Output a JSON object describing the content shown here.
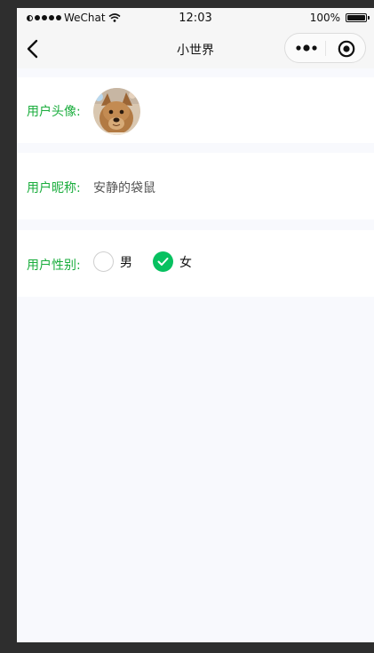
{
  "status_bar": {
    "carrier": "WeChat",
    "time": "12:03",
    "battery": "100%"
  },
  "nav": {
    "title": "小世界",
    "back_icon": "chevron-left-icon",
    "more_icon": "more-dots-icon",
    "close_icon": "record-circle-icon"
  },
  "profile": {
    "avatar_label": "用户头像:",
    "nickname_label": "用户昵称:",
    "nickname_value": "安静的袋鼠",
    "gender_label": "用户性别:",
    "gender_options": [
      {
        "label": "男",
        "checked": false
      },
      {
        "label": "女",
        "checked": true
      }
    ]
  },
  "colors": {
    "label": "#1aad3d",
    "radio_checked": "#07c160",
    "page_bg": "#f8f9fd"
  }
}
